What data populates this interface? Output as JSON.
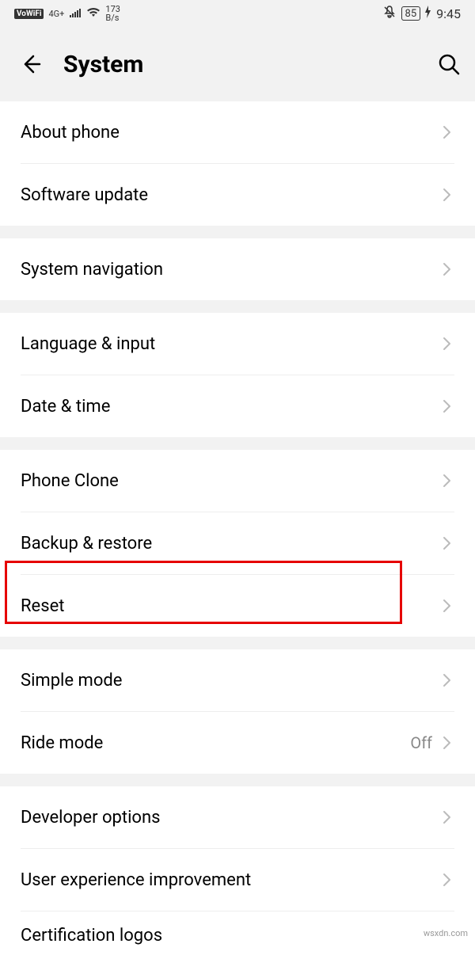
{
  "status": {
    "vowifi": "VoWiFi",
    "network": "4G+",
    "speed_value": "173",
    "speed_unit": "B/s",
    "battery": "85",
    "time": "9:45"
  },
  "header": {
    "title": "System"
  },
  "groups": [
    {
      "items": [
        {
          "name": "about-phone",
          "label": "About phone"
        },
        {
          "name": "software-update",
          "label": "Software update"
        }
      ]
    },
    {
      "items": [
        {
          "name": "system-navigation",
          "label": "System navigation"
        }
      ]
    },
    {
      "items": [
        {
          "name": "language-input",
          "label": "Language & input"
        },
        {
          "name": "date-time",
          "label": "Date & time"
        }
      ]
    },
    {
      "items": [
        {
          "name": "phone-clone",
          "label": "Phone Clone"
        },
        {
          "name": "backup-restore",
          "label": "Backup & restore"
        },
        {
          "name": "reset",
          "label": "Reset",
          "highlighted": true
        }
      ]
    },
    {
      "items": [
        {
          "name": "simple-mode",
          "label": "Simple mode"
        },
        {
          "name": "ride-mode",
          "label": "Ride mode",
          "value": "Off"
        }
      ]
    },
    {
      "items": [
        {
          "name": "developer-options",
          "label": "Developer options"
        },
        {
          "name": "user-experience-improvement",
          "label": "User experience improvement"
        },
        {
          "name": "certification-logos",
          "label": "Certification logos"
        }
      ]
    }
  ],
  "watermark": "wsxdn.com"
}
